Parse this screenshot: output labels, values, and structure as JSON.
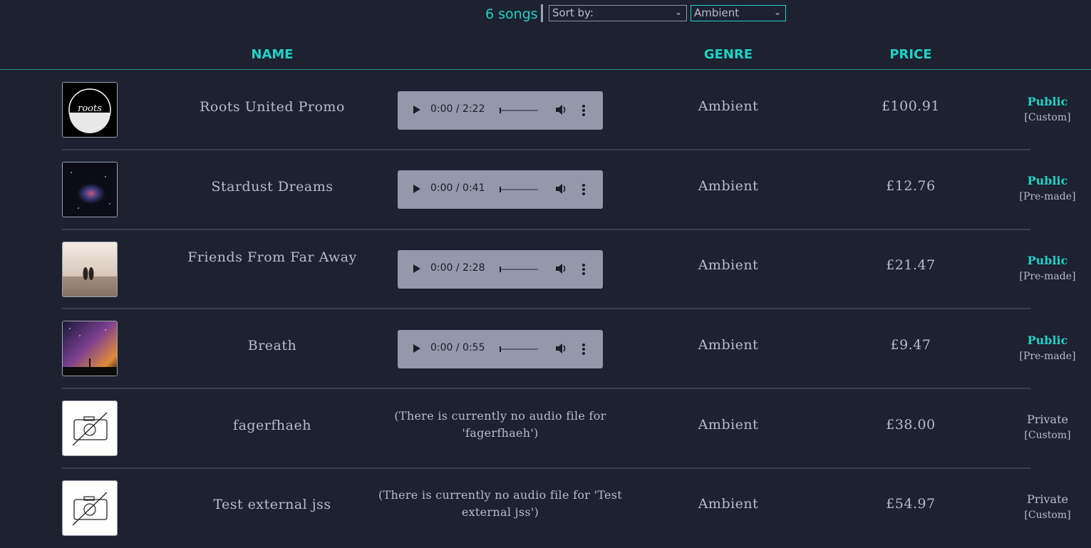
{
  "header": {
    "song_count": "6 songs",
    "sort_select": "Sort by:",
    "genre_select": "Ambient"
  },
  "columns": {
    "name": "NAME",
    "genre": "GENRE",
    "price": "PRICE"
  },
  "songs": [
    {
      "name": "Roots United Promo",
      "time": "0:00 / 2:22",
      "genre": "Ambient",
      "price": "£100.91",
      "status": "Public",
      "kind": "[Custom]"
    },
    {
      "name": "Stardust Dreams",
      "time": "0:00 / 0:41",
      "genre": "Ambient",
      "price": "£12.76",
      "status": "Public",
      "kind": "[Pre-made]"
    },
    {
      "name": "Friends From Far Away",
      "time": "0:00 / 2:28",
      "genre": "Ambient",
      "price": "£21.47",
      "status": "Public",
      "kind": "[Pre-made]"
    },
    {
      "name": "Breath",
      "time": "0:00 / 0:55",
      "genre": "Ambient",
      "price": "£9.47",
      "status": "Public",
      "kind": "[Pre-made]"
    },
    {
      "name": "fagerfhaeh",
      "no_audio": "(There is currently no audio file for 'fagerfhaeh')",
      "genre": "Ambient",
      "price": "£38.00",
      "status": "Private",
      "kind": "[Custom]"
    },
    {
      "name": "Test external jss",
      "no_audio": "(There is currently no audio file for 'Test external jss')",
      "genre": "Ambient",
      "price": "£54.97",
      "status": "Private",
      "kind": "[Custom]"
    }
  ],
  "colors": {
    "accent": "#1fd3c6",
    "background": "#1d2130",
    "text": "#b9bccb"
  }
}
